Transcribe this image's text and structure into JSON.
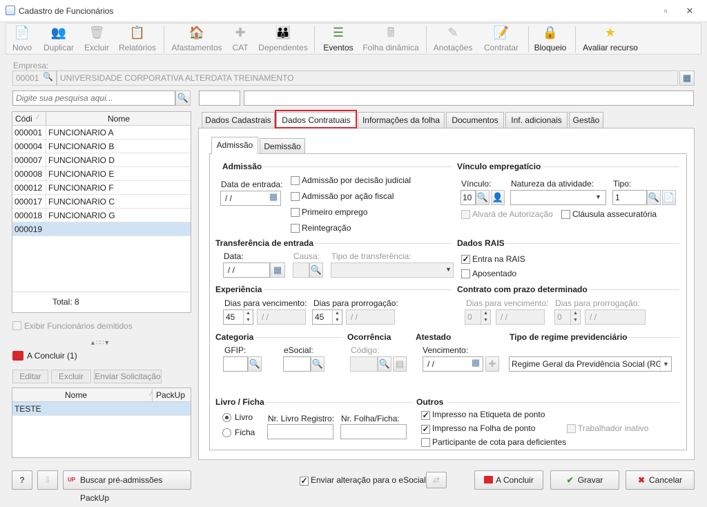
{
  "window": {
    "title": "Cadastro de Funcionários"
  },
  "toolbar": {
    "novo": "Novo",
    "duplicar": "Duplicar",
    "excluir": "Excluir",
    "relatorios": "Relatórios",
    "afastamentos": "Afastamentos",
    "cat": "CAT",
    "dependentes": "Dependentes",
    "eventos": "Eventos",
    "folha_dinamica": "Folha dinâmica",
    "anotacoes": "Anotações",
    "contratar": "Contratar",
    "bloqueio": "Bloqueio",
    "avaliar": "Avaliar recurso"
  },
  "empresa": {
    "label": "Empresa:",
    "code": "00001",
    "name": "UNIVERSIDADE CORPORATIVA ALTERDATA TREINAMENTO"
  },
  "search": {
    "placeholder": "Digite sua pesquisa aqui..."
  },
  "employee_list": {
    "col_code": "Códi",
    "col_name": "Nome",
    "rows": [
      {
        "code": "000001",
        "name": "FUNCIONARIO A"
      },
      {
        "code": "000004",
        "name": "FUNCIONARIO B"
      },
      {
        "code": "000007",
        "name": "FUNCIONARIO D"
      },
      {
        "code": "000008",
        "name": "FUNCIONARIO E"
      },
      {
        "code": "000012",
        "name": "FUNCIONARIO F"
      },
      {
        "code": "000017",
        "name": "FUNCIONARIO C"
      },
      {
        "code": "000018",
        "name": "FUNCIONARIO G"
      },
      {
        "code": "000019",
        "name": ""
      }
    ],
    "total": "Total: 8"
  },
  "exibir_demitidos": "Exibir Funcionários demitidos",
  "a_concluir": {
    "title": "A Concluir (1)",
    "editar": "Editar",
    "excluir": "Excluir",
    "enviar": "Enviar Solicitação",
    "col_nome": "Nome",
    "col_packup": "PackUp",
    "rows": [
      {
        "nome": "TESTE",
        "packup": ""
      }
    ]
  },
  "tabs": [
    "Dados Cadastrais",
    "Dados Contratuais",
    "Informações da folha",
    "Documentos",
    "Inf. adicionais",
    "Gestão"
  ],
  "subtabs": [
    "Admissão",
    "Demissão"
  ],
  "admissao": {
    "title": "Admissão",
    "data_entrada_label": "Data de entrada:",
    "data_entrada": " / /",
    "judicial": "Admissão por decisão judicial",
    "fiscal": "Admissão por ação fiscal",
    "primeiro": "Primeiro emprego",
    "reintegracao": "Reintegração"
  },
  "vinculo": {
    "title": "Vínculo empregatício",
    "vinculo_label": "Vínculo:",
    "vinculo_value": "10",
    "natureza_label": "Natureza da atividade:",
    "tipo_label": "Tipo:",
    "tipo_value": "1",
    "alvara": "Alvará de Autorização",
    "clausula": "Cláusula assecuratória"
  },
  "transferencia": {
    "title": "Transferência de entrada",
    "data_label": "Data:",
    "data_value": " / /",
    "causa_label": "Causa:",
    "tipo_label": "Tipo de transferência:"
  },
  "rais": {
    "title": "Dados RAIS",
    "entra": "Entra na RAIS",
    "aposentado": "Aposentado"
  },
  "experiencia": {
    "title": "Experiência",
    "venc_label": "Dias para vencimento:",
    "venc_value": "45",
    "venc_date": " / /",
    "prorr_label": "Dias para prorrogação:",
    "prorr_value": "45",
    "prorr_date": " / /"
  },
  "contrato": {
    "title": "Contrato com prazo determinado",
    "venc_label": "Dias para vencimento:",
    "venc_value": "0",
    "venc_date": " / /",
    "prorr_label": "Dias para prorrogação:",
    "prorr_value": "0",
    "prorr_date": " / /"
  },
  "categoria": {
    "title": "Categoria",
    "gfip": "GFIP:",
    "esocial": "eSocial:"
  },
  "ocorrencia": {
    "title": "Ocorrência",
    "codigo": "Código:"
  },
  "atestado": {
    "title": "Atestado",
    "vencimento": "Vencimento:",
    "value": " / /"
  },
  "regime": {
    "title": "Tipo de regime previdenciário",
    "value": "Regime Geral da Previdência Social (RGP"
  },
  "livro": {
    "title": "Livro / Ficha",
    "livro": "Livro",
    "ficha": "Ficha",
    "nr_livro": "Nr. Livro Registro:",
    "nr_folha": "Nr. Folha/Ficha:"
  },
  "outros": {
    "title": "Outros",
    "etiqueta": "Impresso na Etiqueta de ponto",
    "folha": "Impresso na Folha de ponto",
    "inativo": "Trabalhador inativo",
    "cota": "Participante de cota para deficientes"
  },
  "footer": {
    "help": "?",
    "buscar": "Buscar pré-admissões PackUp",
    "enviar": "Enviar alteração para o eSocial",
    "a_concluir": "A Concluir",
    "gravar": "Gravar",
    "cancelar": "Cancelar"
  },
  "colors": {
    "accent_red": "#d8262c",
    "selection": "#cfe3f5"
  }
}
